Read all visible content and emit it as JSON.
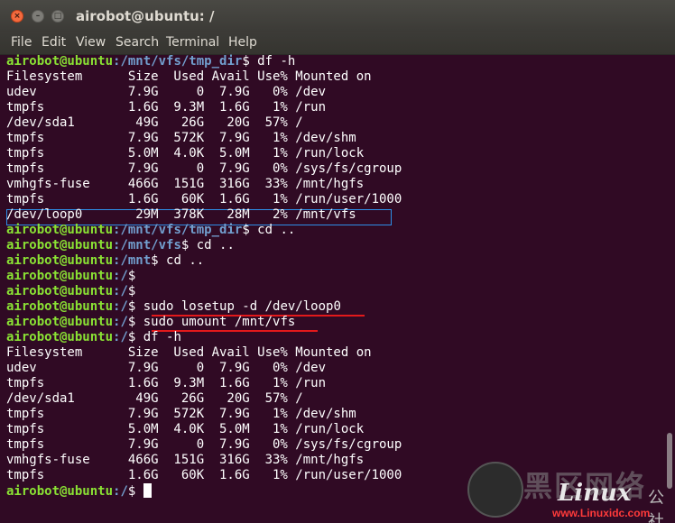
{
  "window": {
    "title": "airobot@ubuntu: /",
    "controls": {
      "close": "×",
      "minimize": "–",
      "maximize": "□"
    }
  },
  "menu": [
    "File",
    "Edit",
    "View",
    "Search",
    "Terminal",
    "Help"
  ],
  "terminal": {
    "lines": [
      {
        "user": "airobot@ubuntu",
        "path": ":/mnt/vfs/tmp_dir",
        "cmd": "$ df -h"
      },
      {
        "text": "Filesystem      Size  Used Avail Use% Mounted on"
      },
      {
        "text": "udev            7.9G     0  7.9G   0% /dev"
      },
      {
        "text": "tmpfs           1.6G  9.3M  1.6G   1% /run"
      },
      {
        "text": "/dev/sda1        49G   26G   20G  57% /"
      },
      {
        "text": "tmpfs           7.9G  572K  7.9G   1% /dev/shm"
      },
      {
        "text": "tmpfs           5.0M  4.0K  5.0M   1% /run/lock"
      },
      {
        "text": "tmpfs           7.9G     0  7.9G   0% /sys/fs/cgroup"
      },
      {
        "text": "vmhgfs-fuse     466G  151G  316G  33% /mnt/hgfs"
      },
      {
        "text": "tmpfs           1.6G   60K  1.6G   1% /run/user/1000"
      },
      {
        "text": "/dev/loop0       29M  378K   28M   2% /mnt/vfs"
      },
      {
        "user": "airobot@ubuntu",
        "path": ":/mnt/vfs/tmp_dir",
        "cmd": "$ cd .."
      },
      {
        "user": "airobot@ubuntu",
        "path": ":/mnt/vfs",
        "cmd": "$ cd .."
      },
      {
        "user": "airobot@ubuntu",
        "path": ":/mnt",
        "cmd": "$ cd .."
      },
      {
        "user": "airobot@ubuntu",
        "path": ":/",
        "cmd": "$"
      },
      {
        "user": "airobot@ubuntu",
        "path": ":/",
        "cmd": "$"
      },
      {
        "user": "airobot@ubuntu",
        "path": ":/",
        "cmd": "$ sudo losetup -d /dev/loop0"
      },
      {
        "user": "airobot@ubuntu",
        "path": ":/",
        "cmd": "$ sudo umount /mnt/vfs"
      },
      {
        "user": "airobot@ubuntu",
        "path": ":/",
        "cmd": "$ df -h"
      },
      {
        "text": "Filesystem      Size  Used Avail Use% Mounted on"
      },
      {
        "text": "udev            7.9G     0  7.9G   0% /dev"
      },
      {
        "text": "tmpfs           1.6G  9.3M  1.6G   1% /run"
      },
      {
        "text": "/dev/sda1        49G   26G   20G  57% /"
      },
      {
        "text": "tmpfs           7.9G  572K  7.9G   1% /dev/shm"
      },
      {
        "text": "tmpfs           5.0M  4.0K  5.0M   1% /run/lock"
      },
      {
        "text": "tmpfs           7.9G     0  7.9G   0% /sys/fs/cgroup"
      },
      {
        "text": "vmhgfs-fuse     466G  151G  316G  33% /mnt/hgfs"
      },
      {
        "text": "tmpfs           1.6G   60K  1.6G   1% /run/user/1000"
      },
      {
        "user": "airobot@ubuntu",
        "path": ":/",
        "cmd": "$ ",
        "cursor": true
      }
    ]
  },
  "watermark": {
    "glyphs": "黑区网络",
    "brand": "Linux",
    "cn": "公社",
    "url": "www.Linuxidc.com"
  },
  "colors": {
    "background": "#300a24",
    "user": "#8ae234",
    "path": "#729fcf",
    "highlight_box": "#2d8fe8",
    "underline": "#e3191b"
  }
}
